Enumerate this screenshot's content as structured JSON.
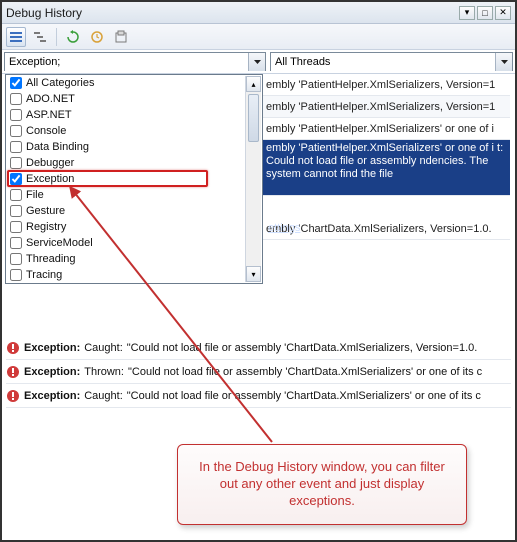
{
  "window": {
    "title": "Debug History"
  },
  "filters": {
    "exception_value": "Exception;",
    "threads_value": "All Threads"
  },
  "categories": [
    {
      "label": "All Categories",
      "checked": true
    },
    {
      "label": "ADO.NET",
      "checked": false
    },
    {
      "label": "ASP.NET",
      "checked": false
    },
    {
      "label": "Console",
      "checked": false
    },
    {
      "label": "Data Binding",
      "checked": false
    },
    {
      "label": "Debugger",
      "checked": false
    },
    {
      "label": "Exception",
      "checked": true
    },
    {
      "label": "File",
      "checked": false
    },
    {
      "label": "Gesture",
      "checked": false
    },
    {
      "label": "Registry",
      "checked": false
    },
    {
      "label": "ServiceModel",
      "checked": false
    },
    {
      "label": "Threading",
      "checked": false
    },
    {
      "label": "Tracing",
      "checked": false
    }
  ],
  "events_right": [
    {
      "text": "embly 'PatientHelper.XmlSerializers, Version=1"
    },
    {
      "text": "embly 'PatientHelper.XmlSerializers, Version=1"
    },
    {
      "text": "embly 'PatientHelper.XmlSerializers' or one of i"
    },
    {
      "text": "embly 'PatientHelper.XmlSerializers' or one of i t: Could not load file or assembly ndencies. The system cannot find the file",
      "selected": true
    },
    {
      "text": "ettings",
      "link": true
    },
    {
      "text": "embly 'ChartData.XmlSerializers, Version=1.0."
    }
  ],
  "events_full": [
    {
      "label": "Exception:",
      "kind": "Caught:",
      "msg": "\"Could not load file or assembly 'ChartData.XmlSerializers, Version=1.0."
    },
    {
      "label": "Exception:",
      "kind": "Thrown:",
      "msg": "\"Could not load file or assembly 'ChartData.XmlSerializers' or one of its c"
    },
    {
      "label": "Exception:",
      "kind": "Caught:",
      "msg": "\"Could not load file or assembly 'ChartData.XmlSerializers' or one of its c"
    }
  ],
  "callout": {
    "text": "In the Debug History window, you can filter out any other event and just display exceptions."
  }
}
